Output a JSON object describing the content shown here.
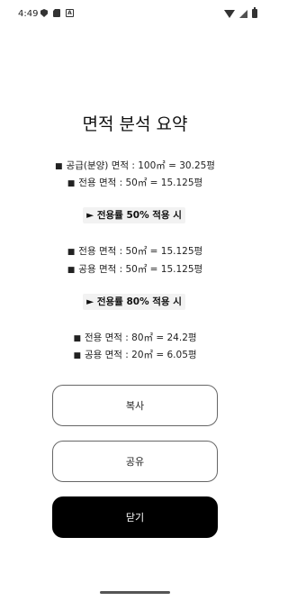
{
  "status_bar": {
    "time": "4:49",
    "left_icons": [
      "shield-icon",
      "sd-card-icon",
      "a-icon"
    ],
    "right_icons": [
      "wifi-icon",
      "signal-icon",
      "battery-icon"
    ]
  },
  "summary": {
    "title": "면적 분석 요약",
    "base_lines": [
      "공급(분양) 면적 : 100㎡ = 30.25평",
      "전용 면적 : 50㎡ = 15.125평"
    ],
    "scenarios": [
      {
        "label": "► 전용률 50% 적용 시",
        "lines": [
          "전용 면적 : 50㎡ = 15.125평",
          "공용 면적 : 50㎡ = 15.125평"
        ]
      },
      {
        "label": "► 전용률 80% 적용 시",
        "lines": [
          "전용 면적 : 80㎡ = 24.2평",
          "공용 면적 : 20㎡ = 6.05평"
        ]
      }
    ],
    "bullet": "■"
  },
  "actions": {
    "copy_label": "복사",
    "share_label": "공유",
    "close_label": "닫기"
  }
}
